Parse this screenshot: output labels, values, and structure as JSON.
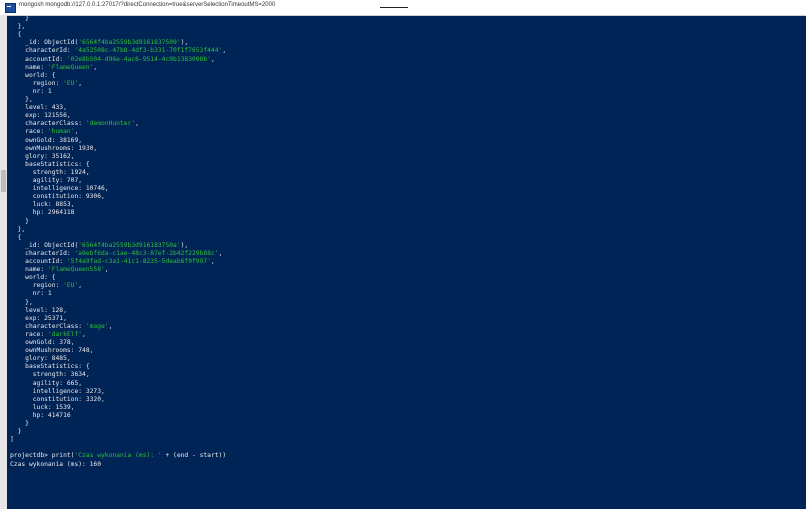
{
  "window": {
    "title": "mongosh mongodb://127.0.0.1:27017/?directConnection=true&serverSelectionTimeoutMS=2000",
    "icon": "terminal-icon"
  },
  "colors": {
    "background": "#012456",
    "text": "#eaeaea",
    "string": "#2fbf3a"
  },
  "lines": [
    {
      "i": "    ",
      "t": "}"
    },
    {
      "i": "  ",
      "t": "},"
    },
    {
      "i": "  ",
      "t": "{"
    },
    {
      "i": "    ",
      "t": "_id: ObjectId(",
      "v": "'6564f4ba2559b3d9161837509'",
      "s": "),"
    },
    {
      "i": "    ",
      "t": "characterId: ",
      "v": "'4a52508c-47b8-4df3-b331-70f1f7653f444'",
      "s": ","
    },
    {
      "i": "    ",
      "t": "accountId: ",
      "v": "'02e8b504-d96e-4ac6-9514-4c9b1383098b'",
      "s": ","
    },
    {
      "i": "    ",
      "t": "name: ",
      "v": "'FlameQueen'",
      "s": ","
    },
    {
      "i": "    ",
      "t": "world: {"
    },
    {
      "i": "      ",
      "t": "region: ",
      "v": "'EU'",
      "s": ","
    },
    {
      "i": "      ",
      "t": "nr: 1"
    },
    {
      "i": "    ",
      "t": "},"
    },
    {
      "i": "    ",
      "t": "level: 433,"
    },
    {
      "i": "    ",
      "t": "exp: 121556,"
    },
    {
      "i": "    ",
      "t": "characterClass: ",
      "v": "'demonHunter'",
      "s": ","
    },
    {
      "i": "    ",
      "t": "race: ",
      "v": "'human'",
      "s": ","
    },
    {
      "i": "    ",
      "t": "ownGold: 38169,"
    },
    {
      "i": "    ",
      "t": "ownMushrooms: 1930,"
    },
    {
      "i": "    ",
      "t": "glory: 35162,"
    },
    {
      "i": "    ",
      "t": "baseStatistics: {"
    },
    {
      "i": "      ",
      "t": "strength: 1924,"
    },
    {
      "i": "      ",
      "t": "agility: 707,"
    },
    {
      "i": "      ",
      "t": "intelligence: 10746,"
    },
    {
      "i": "      ",
      "t": "constitution: 9306,"
    },
    {
      "i": "      ",
      "t": "luck: 8853,"
    },
    {
      "i": "      ",
      "t": "hp: 2964118"
    },
    {
      "i": "    ",
      "t": "}"
    },
    {
      "i": "  ",
      "t": "},"
    },
    {
      "i": "  ",
      "t": "{"
    },
    {
      "i": "    ",
      "t": "_id: ObjectId(",
      "v": "'6564f4ba2559b3d916183750a'",
      "s": "),"
    },
    {
      "i": "    ",
      "t": "characterId: ",
      "v": "'a9ebf6da-c1ae-48c3-87ef-2b42f229b88c'",
      "s": ","
    },
    {
      "i": "    ",
      "t": "accountId: ",
      "v": "'5f4a9fad-c3a1-41c1-8235-5deab6f0f997'",
      "s": ","
    },
    {
      "i": "    ",
      "t": "name: ",
      "v": "'FlameQueen558'",
      "s": ","
    },
    {
      "i": "    ",
      "t": "world: {"
    },
    {
      "i": "      ",
      "t": "region: ",
      "v": "'EU'",
      "s": ","
    },
    {
      "i": "      ",
      "t": "nr: 1"
    },
    {
      "i": "    ",
      "t": "},"
    },
    {
      "i": "    ",
      "t": "level: 128,"
    },
    {
      "i": "    ",
      "t": "exp: 25371,"
    },
    {
      "i": "    ",
      "t": "characterClass: ",
      "v": "'mage'",
      "s": ","
    },
    {
      "i": "    ",
      "t": "race: ",
      "v": "'darkElf'",
      "s": ","
    },
    {
      "i": "    ",
      "t": "ownGold: 378,"
    },
    {
      "i": "    ",
      "t": "ownMushrooms: 748,"
    },
    {
      "i": "    ",
      "t": "glory: 8485,"
    },
    {
      "i": "    ",
      "t": "baseStatistics: {"
    },
    {
      "i": "      ",
      "t": "strength: 3634,"
    },
    {
      "i": "      ",
      "t": "agility: 665,"
    },
    {
      "i": "      ",
      "t": "intelligence: 3273,"
    },
    {
      "i": "      ",
      "t": "constitution: 3320,"
    },
    {
      "i": "      ",
      "t": "luck: 1539,"
    },
    {
      "i": "      ",
      "t": "hp: 414716"
    },
    {
      "i": "    ",
      "t": "}"
    },
    {
      "i": "  ",
      "t": "}"
    },
    {
      "i": "",
      "t": "]"
    },
    {
      "i": "",
      "t": ""
    },
    {
      "i": "",
      "t": "projectdb> print(",
      "v": "'Czas wykonania (ms): '",
      "s": " + (end - start))"
    },
    {
      "i": "",
      "t": "Czas wykonania (ms): 160"
    }
  ]
}
